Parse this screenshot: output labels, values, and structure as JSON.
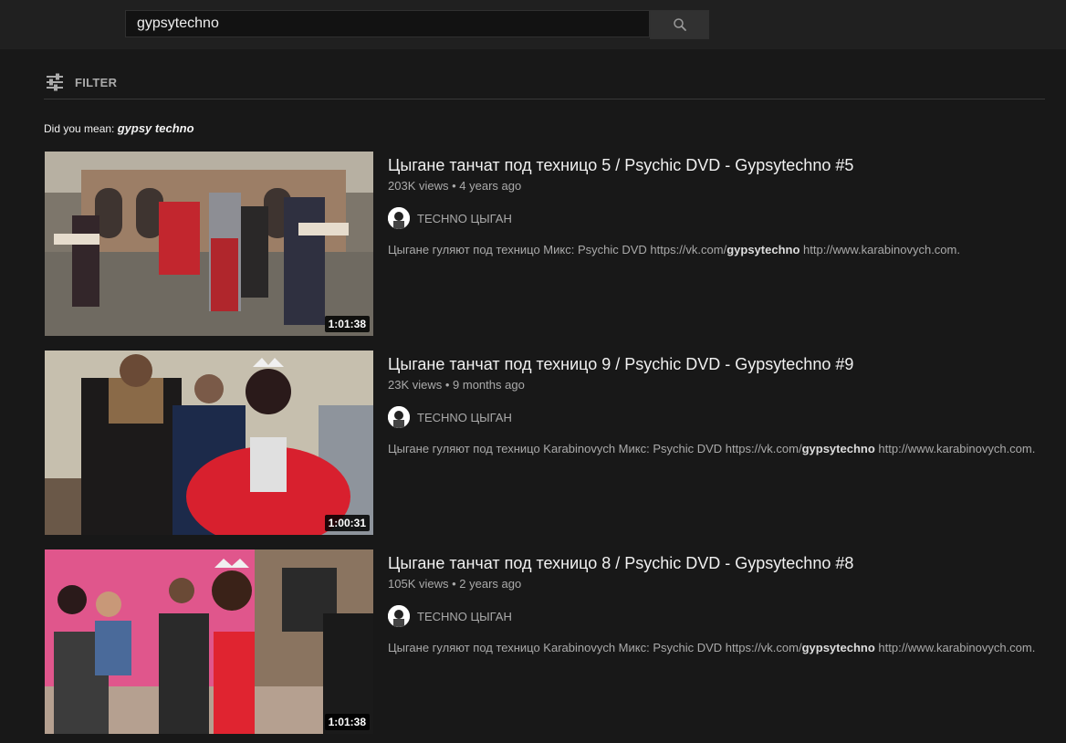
{
  "search": {
    "value": "gypsytechno",
    "button_icon": "search-icon"
  },
  "filter": {
    "icon": "sliders-icon",
    "label": "FILTER"
  },
  "suggestion": {
    "prefix": "Did you mean:",
    "query": "gypsy techno"
  },
  "results": [
    {
      "title": "Цыгане танчат под техницо 5 / Psychic DVD - Gypsytechno #5",
      "views": "203K views",
      "age": "4 years ago",
      "channel": "TECHNO ЦЫГАН",
      "desc_before": "Цыгане гуляют под техницо Микс: Psychic DVD https://vk.com/",
      "desc_bold": "gypsytechno",
      "desc_after": " http://www.karabinovych.com.",
      "duration": "1:01:38",
      "thumb_colors": [
        "#8e8376",
        "#a39482",
        "#c2262e",
        "#3a3434"
      ]
    },
    {
      "title": "Цыгане танчат под техницо 9 / Psychic DVD - Gypsytechno #9",
      "views": "23K views",
      "age": "9 months ago",
      "channel": "TECHNO ЦЫГАН",
      "desc_before": "Цыгане гуляют под техницо Karabinovych Микс: Psychic DVD https://vk.com/",
      "desc_bold": "gypsytechno",
      "desc_after": " http://www.karabinovych.com.",
      "duration": "1:00:31",
      "thumb_colors": [
        "#c9c2b2",
        "#1e1a1a",
        "#d8202e",
        "#7c6a55"
      ]
    },
    {
      "title": "Цыгане танчат под техницо 8 / Psychic DVD - Gypsytechno #8",
      "views": "105K views",
      "age": "2 years ago",
      "channel": "TECHNO ЦЫГАН",
      "desc_before": "Цыгане гуляют под техницо Karabinovych Микс: Psychic DVD https://vk.com/",
      "desc_bold": "gypsytechno",
      "desc_after": " http://www.karabinovych.com.",
      "duration": "1:01:38",
      "thumb_colors": [
        "#e0568c",
        "#3c3c3c",
        "#e02430",
        "#8a7460"
      ]
    }
  ]
}
